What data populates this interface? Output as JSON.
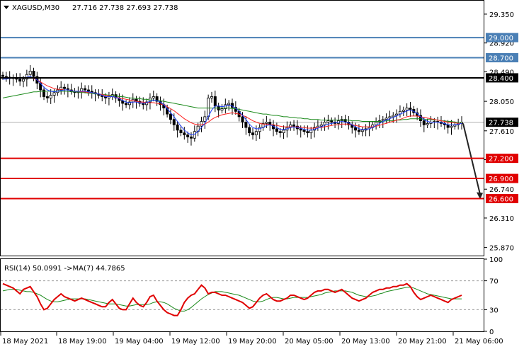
{
  "header": {
    "symbol_text": "XAGUSD,M30",
    "ohlc_text": "27.716 27.738 27.693 27.738"
  },
  "colors": {
    "background": "#ffffff",
    "candle": "#000000",
    "ma_fast": "#1f3fff",
    "ma_mid": "#ff2020",
    "ma_slow": "#1b8a1b",
    "resistance": "#4a7fb5",
    "pivot": "#000000",
    "support": "#e00000",
    "rsi_line": "#e00000",
    "rsi_ma": "#1b8a1b"
  },
  "chart_data": [
    {
      "type": "candlestick",
      "title": "XAGUSD,M30",
      "ylim": [
        25.75,
        29.55
      ],
      "y_ticks": [
        "29.350",
        "28.920",
        "28.490",
        "28.050",
        "27.610",
        "27.180",
        "26.740",
        "26.310",
        "25.870"
      ],
      "last_price": "27.738",
      "levels": [
        {
          "label": "29.000",
          "value": 29.0,
          "role": "resistance"
        },
        {
          "label": "28.700",
          "value": 28.7,
          "role": "resistance"
        },
        {
          "label": "28.400",
          "value": 28.4,
          "role": "pivot"
        },
        {
          "label": "27.200",
          "value": 27.2,
          "role": "support"
        },
        {
          "label": "26.900",
          "value": 26.9,
          "role": "support"
        },
        {
          "label": "26.600",
          "value": 26.6,
          "role": "support"
        }
      ],
      "forecast_arrow": {
        "from": 27.72,
        "to": 26.6
      },
      "closes": [
        28.42,
        28.41,
        28.39,
        28.4,
        28.38,
        28.35,
        28.38,
        28.45,
        28.5,
        28.42,
        28.32,
        28.22,
        28.12,
        28.1,
        28.14,
        28.18,
        28.22,
        28.26,
        28.24,
        28.22,
        28.2,
        28.18,
        28.2,
        28.24,
        28.22,
        28.2,
        28.18,
        28.16,
        28.14,
        28.12,
        28.1,
        28.12,
        28.15,
        28.1,
        28.06,
        28.02,
        28.0,
        28.04,
        28.08,
        28.05,
        28.02,
        28.0,
        28.04,
        28.1,
        28.12,
        28.05,
        28.0,
        27.95,
        27.86,
        27.78,
        27.7,
        27.62,
        27.58,
        27.55,
        27.52,
        27.5,
        27.6,
        27.68,
        27.75,
        27.82,
        28.1,
        28.12,
        27.98,
        27.92,
        27.94,
        28.0,
        28.02,
        27.96,
        27.9,
        27.82,
        27.74,
        27.66,
        27.58,
        27.55,
        27.6,
        27.66,
        27.72,
        27.74,
        27.7,
        27.64,
        27.6,
        27.58,
        27.62,
        27.66,
        27.7,
        27.68,
        27.64,
        27.62,
        27.6,
        27.58,
        27.62,
        27.66,
        27.68,
        27.7,
        27.74,
        27.76,
        27.74,
        27.72,
        27.76,
        27.78,
        27.74,
        27.7,
        27.66,
        27.62,
        27.6,
        27.62,
        27.64,
        27.66,
        27.7,
        27.74,
        27.76,
        27.78,
        27.8,
        27.82,
        27.84,
        27.86,
        27.9,
        27.92,
        27.95,
        27.93,
        27.88,
        27.84,
        27.76,
        27.7,
        27.72,
        27.74,
        27.75,
        27.74,
        27.72,
        27.7,
        27.66,
        27.68,
        27.7,
        27.72,
        27.738
      ],
      "ma_fast": [
        28.38,
        28.38,
        28.39,
        28.4,
        28.4,
        28.39,
        28.4,
        28.41,
        28.42,
        28.4,
        28.37,
        28.32,
        28.26,
        28.22,
        28.2,
        28.19,
        28.2,
        28.21,
        28.22,
        28.22,
        28.21,
        28.2,
        28.2,
        28.2,
        28.2,
        28.19,
        28.18,
        28.17,
        28.16,
        28.14,
        28.12,
        28.12,
        28.12,
        28.11,
        28.09,
        28.06,
        28.04,
        28.03,
        28.04,
        28.04,
        28.03,
        28.02,
        28.03,
        28.05,
        28.07,
        28.06,
        28.04,
        28.0,
        27.94,
        27.88,
        27.82,
        27.75,
        27.68,
        27.62,
        27.58,
        27.55,
        27.56,
        27.6,
        27.66,
        27.72,
        27.82,
        27.92,
        27.98,
        27.98,
        27.97,
        27.98,
        27.99,
        27.98,
        27.95,
        27.9,
        27.84,
        27.78,
        27.71,
        27.66,
        27.64,
        27.64,
        27.66,
        27.69,
        27.7,
        27.68,
        27.66,
        27.63,
        27.63,
        27.64,
        27.66,
        27.67,
        27.66,
        27.65,
        27.63,
        27.62,
        27.62,
        27.63,
        27.65,
        27.67,
        27.69,
        27.71,
        27.72,
        27.73,
        27.74,
        27.75,
        27.74,
        27.73,
        27.7,
        27.67,
        27.64,
        27.63,
        27.63,
        27.64,
        27.66,
        27.69,
        27.72,
        27.75,
        27.77,
        27.79,
        27.81,
        27.83,
        27.86,
        27.88,
        27.91,
        27.92,
        27.9,
        27.87,
        27.82,
        27.78,
        27.75,
        27.74,
        27.74,
        27.74,
        27.73,
        27.72,
        27.7,
        27.7,
        27.7,
        27.71,
        27.72
      ],
      "ma_mid": [
        28.4,
        28.4,
        28.4,
        28.4,
        28.4,
        28.4,
        28.4,
        28.4,
        28.4,
        28.39,
        28.37,
        28.34,
        28.31,
        28.28,
        28.26,
        28.24,
        28.23,
        28.23,
        28.22,
        28.22,
        28.21,
        28.2,
        28.2,
        28.19,
        28.19,
        28.18,
        28.18,
        28.17,
        28.16,
        28.15,
        28.14,
        28.13,
        28.12,
        28.11,
        28.1,
        28.09,
        28.08,
        28.07,
        28.06,
        28.05,
        28.04,
        28.04,
        28.03,
        28.03,
        28.03,
        28.02,
        28.01,
        28.0,
        27.97,
        27.94,
        27.91,
        27.87,
        27.83,
        27.79,
        27.76,
        27.73,
        27.71,
        27.7,
        27.7,
        27.71,
        27.74,
        27.78,
        27.81,
        27.83,
        27.85,
        27.86,
        27.87,
        27.88,
        27.87,
        27.86,
        27.84,
        27.82,
        27.79,
        27.76,
        27.74,
        27.72,
        27.71,
        27.71,
        27.7,
        27.7,
        27.69,
        27.68,
        27.67,
        27.67,
        27.67,
        27.67,
        27.67,
        27.66,
        27.66,
        27.65,
        27.65,
        27.65,
        27.66,
        27.66,
        27.67,
        27.68,
        27.69,
        27.7,
        27.7,
        27.71,
        27.71,
        27.71,
        27.7,
        27.69,
        27.68,
        27.67,
        27.67,
        27.67,
        27.67,
        27.68,
        27.69,
        27.71,
        27.72,
        27.74,
        27.75,
        27.77,
        27.78,
        27.8,
        27.82,
        27.83,
        27.83,
        27.83,
        27.82,
        27.81,
        27.8,
        27.79,
        27.78,
        27.77,
        27.76,
        27.75,
        27.74,
        27.73,
        27.73,
        27.72,
        27.72
      ],
      "ma_slow": [
        28.1,
        28.11,
        28.12,
        28.13,
        28.14,
        28.15,
        28.16,
        28.17,
        28.18,
        28.19,
        28.19,
        28.2,
        28.2,
        28.2,
        28.2,
        28.2,
        28.2,
        28.2,
        28.2,
        28.2,
        28.19,
        28.19,
        28.19,
        28.18,
        28.18,
        28.17,
        28.17,
        28.16,
        28.16,
        28.15,
        28.15,
        28.14,
        28.14,
        28.13,
        28.12,
        28.12,
        28.11,
        28.1,
        28.1,
        28.09,
        28.09,
        28.08,
        28.08,
        28.07,
        28.07,
        28.06,
        28.06,
        28.05,
        28.04,
        28.03,
        28.02,
        28.01,
        28.0,
        27.99,
        27.98,
        27.97,
        27.96,
        27.95,
        27.95,
        27.95,
        27.95,
        27.95,
        27.95,
        27.95,
        27.95,
        27.95,
        27.95,
        27.94,
        27.94,
        27.93,
        27.92,
        27.91,
        27.9,
        27.89,
        27.88,
        27.87,
        27.86,
        27.86,
        27.85,
        27.84,
        27.84,
        27.83,
        27.82,
        27.82,
        27.81,
        27.81,
        27.8,
        27.8,
        27.79,
        27.79,
        27.78,
        27.78,
        27.78,
        27.77,
        27.77,
        27.77,
        27.77,
        27.77,
        27.77,
        27.77,
        27.77,
        27.77,
        27.76,
        27.76,
        27.76,
        27.75,
        27.75,
        27.75,
        27.75,
        27.75,
        27.75,
        27.75,
        27.76,
        27.76,
        27.76,
        27.77,
        27.77,
        27.78,
        27.78,
        27.79,
        27.79,
        27.79,
        27.79,
        27.78,
        27.78,
        27.78,
        27.77,
        27.77,
        27.76,
        27.76,
        27.75,
        27.75,
        27.74,
        27.74,
        27.74
      ]
    },
    {
      "type": "line",
      "title": "RSI(14) 50.0991 ->MA(7) 44.7865",
      "label_text": "RSI(14) 50.0991  ->MA(7) 44.7865",
      "ylim": [
        0,
        100
      ],
      "y_ticks": [
        "100",
        "70",
        "30",
        "0"
      ],
      "guides": [
        70,
        30
      ],
      "rsi": [
        66,
        64,
        62,
        60,
        56,
        52,
        58,
        60,
        62,
        55,
        48,
        38,
        30,
        32,
        38,
        44,
        48,
        52,
        48,
        46,
        44,
        42,
        44,
        46,
        44,
        42,
        40,
        38,
        36,
        34,
        34,
        40,
        44,
        38,
        32,
        30,
        30,
        38,
        46,
        40,
        36,
        34,
        40,
        48,
        50,
        42,
        36,
        30,
        26,
        24,
        22,
        22,
        30,
        40,
        46,
        50,
        52,
        58,
        64,
        60,
        52,
        54,
        54,
        52,
        50,
        50,
        48,
        46,
        44,
        42,
        40,
        36,
        32,
        34,
        40,
        46,
        50,
        52,
        48,
        44,
        42,
        42,
        44,
        46,
        50,
        50,
        48,
        46,
        44,
        46,
        50,
        54,
        56,
        56,
        58,
        58,
        56,
        54,
        56,
        58,
        54,
        50,
        46,
        44,
        42,
        44,
        46,
        50,
        54,
        56,
        58,
        58,
        60,
        60,
        62,
        62,
        64,
        64,
        66,
        62,
        54,
        48,
        44,
        46,
        48,
        50,
        48,
        46,
        44,
        42,
        40,
        44,
        46,
        48,
        50
      ],
      "rsi_ma": [
        56,
        57,
        58,
        58,
        58,
        57,
        56,
        55,
        55,
        54,
        52,
        50,
        47,
        44,
        42,
        41,
        41,
        42,
        43,
        44,
        45,
        45,
        45,
        45,
        45,
        44,
        43,
        42,
        41,
        40,
        39,
        38,
        38,
        38,
        37,
        36,
        35,
        35,
        36,
        37,
        37,
        37,
        37,
        38,
        40,
        41,
        41,
        40,
        38,
        35,
        32,
        30,
        28,
        28,
        30,
        33,
        37,
        41,
        45,
        48,
        51,
        53,
        55,
        55,
        55,
        54,
        53,
        52,
        51,
        50,
        48,
        46,
        44,
        42,
        41,
        41,
        42,
        44,
        46,
        47,
        47,
        46,
        45,
        45,
        46,
        47,
        47,
        47,
        47,
        47,
        48,
        49,
        50,
        51,
        53,
        54,
        55,
        56,
        56,
        56,
        56,
        55,
        54,
        52,
        50,
        49,
        48,
        48,
        49,
        50,
        52,
        53,
        55,
        56,
        57,
        58,
        59,
        60,
        61,
        61,
        60,
        58,
        56,
        54,
        52,
        51,
        50,
        49,
        48,
        47,
        46,
        45,
        45,
        45,
        45
      ],
      "x_tick_labels": [
        "18 May 2021",
        "18 May 19:00",
        "19 May 04:00",
        "19 May 12:00",
        "19 May 20:00",
        "20 May 05:00",
        "20 May 13:00",
        "20 May 21:00",
        "21 May 06:00"
      ]
    }
  ]
}
